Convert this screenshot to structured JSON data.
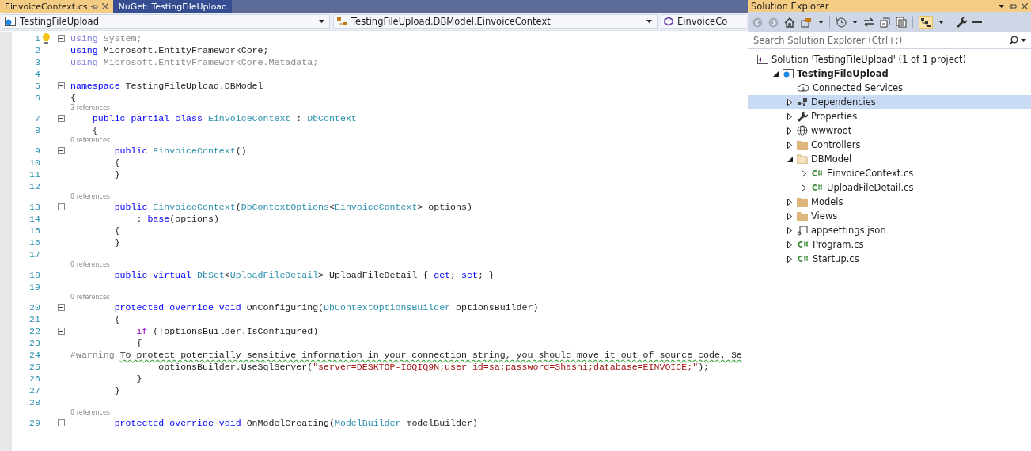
{
  "tabs": [
    {
      "label": "EinvoiceContext.cs",
      "selected": true,
      "pinned": true
    },
    {
      "label": "NuGet: TestingFileUpload",
      "selected": false,
      "pinned": false
    }
  ],
  "nav_bar": [
    {
      "label": "TestingFileUpload",
      "kind": "project"
    },
    {
      "label": "TestingFileUpload.DBModel.EinvoiceContext",
      "kind": "class"
    },
    {
      "label": "EinvoiceCo",
      "kind": "member"
    }
  ],
  "editor": {
    "lines": [
      {
        "number": "1",
        "fold": true,
        "lightbulb": true,
        "tokens": [
          {
            "kind": "unused_kw",
            "text": "using"
          },
          {
            "kind": "unused",
            "text": " System;"
          }
        ]
      },
      {
        "number": "2",
        "fold": false,
        "lightbulb": false,
        "tokens": [
          {
            "kind": "kw",
            "text": "using"
          },
          {
            "kind": "plain",
            "text": " Microsoft.EntityFrameworkCore;"
          }
        ]
      },
      {
        "number": "3",
        "fold": false,
        "lightbulb": false,
        "tokens": [
          {
            "kind": "unused_kw",
            "text": "using"
          },
          {
            "kind": "unused",
            "text": " Microsoft.EntityFrameworkCore.Metadata;"
          }
        ]
      },
      {
        "number": "4",
        "fold": false,
        "lightbulb": false
      },
      {
        "number": "5",
        "fold": true,
        "lightbulb": false,
        "tokens": [
          {
            "kind": "kw",
            "text": "namespace"
          },
          {
            "kind": "plain",
            "text": " TestingFileUpload.DBModel"
          }
        ]
      },
      {
        "number": "6",
        "fold": false,
        "lightbulb": false,
        "tokens": [
          {
            "kind": "plain",
            "text": "{"
          }
        ]
      },
      {
        "number": "7",
        "fold": true,
        "lightbulb": false,
        "codelens": "3 references",
        "tokens": [
          {
            "kind": "kw",
            "text": "    public partial class"
          },
          {
            "kind": "type",
            "text": " EinvoiceContext"
          },
          {
            "kind": "plain",
            "text": " : "
          },
          {
            "kind": "type",
            "text": "DbContext"
          }
        ]
      },
      {
        "number": "8",
        "fold": false,
        "lightbulb": false,
        "tokens": [
          {
            "kind": "plain",
            "text": "    {"
          }
        ]
      },
      {
        "number": "9",
        "fold": true,
        "lightbulb": false,
        "codelens": "0 references",
        "tokens": [
          {
            "kind": "kw",
            "text": "        public"
          },
          {
            "kind": "type",
            "text": " EinvoiceContext"
          },
          {
            "kind": "plain",
            "text": "()"
          }
        ]
      },
      {
        "number": "10",
        "fold": false,
        "lightbulb": false,
        "tokens": [
          {
            "kind": "plain",
            "text": "        {"
          }
        ]
      },
      {
        "number": "11",
        "fold": false,
        "lightbulb": false,
        "tokens": [
          {
            "kind": "plain",
            "text": "        }"
          }
        ]
      },
      {
        "number": "12",
        "fold": false,
        "lightbulb": false
      },
      {
        "number": "13",
        "fold": true,
        "lightbulb": false,
        "codelens": "0 references",
        "tokens": [
          {
            "kind": "kw",
            "text": "        public"
          },
          {
            "kind": "type",
            "text": " EinvoiceContext"
          },
          {
            "kind": "plain",
            "text": "("
          },
          {
            "kind": "type",
            "text": "DbContextOptions"
          },
          {
            "kind": "plain",
            "text": "<"
          },
          {
            "kind": "type",
            "text": "EinvoiceContext"
          },
          {
            "kind": "plain",
            "text": "> options)"
          }
        ]
      },
      {
        "number": "14",
        "fold": false,
        "lightbulb": false,
        "tokens": [
          {
            "kind": "plain",
            "text": "            : "
          },
          {
            "kind": "kw",
            "text": "base"
          },
          {
            "kind": "plain",
            "text": "(options)"
          }
        ]
      },
      {
        "number": "15",
        "fold": false,
        "lightbulb": false,
        "tokens": [
          {
            "kind": "plain",
            "text": "        {"
          }
        ]
      },
      {
        "number": "16",
        "fold": false,
        "lightbulb": false,
        "tokens": [
          {
            "kind": "plain",
            "text": "        }"
          }
        ]
      },
      {
        "number": "17",
        "fold": false,
        "lightbulb": false
      },
      {
        "number": "18",
        "fold": false,
        "lightbulb": false,
        "codelens": "0 references",
        "tokens": [
          {
            "kind": "kw",
            "text": "        public virtual"
          },
          {
            "kind": "type",
            "text": " DbSet"
          },
          {
            "kind": "plain",
            "text": "<"
          },
          {
            "kind": "type",
            "text": "UploadFileDetail"
          },
          {
            "kind": "plain",
            "text": "> UploadFileDetail { "
          },
          {
            "kind": "kw",
            "text": "get"
          },
          {
            "kind": "plain",
            "text": "; "
          },
          {
            "kind": "kw",
            "text": "set"
          },
          {
            "kind": "plain",
            "text": "; }"
          }
        ]
      },
      {
        "number": "19",
        "fold": false,
        "lightbulb": false
      },
      {
        "number": "20",
        "fold": true,
        "lightbulb": false,
        "codelens": "0 references",
        "tokens": [
          {
            "kind": "kw",
            "text": "        protected override void"
          },
          {
            "kind": "plain",
            "text": " OnConfiguring("
          },
          {
            "kind": "type",
            "text": "DbContextOptionsBuilder"
          },
          {
            "kind": "plain",
            "text": " optionsBuilder)"
          }
        ]
      },
      {
        "number": "21",
        "fold": false,
        "lightbulb": false,
        "tokens": [
          {
            "kind": "plain",
            "text": "        {"
          }
        ]
      },
      {
        "number": "22",
        "fold": true,
        "lightbulb": false,
        "tokens": [
          {
            "kind": "ctrl",
            "text": "            if"
          },
          {
            "kind": "plain",
            "text": " (!optionsBuilder.IsConfigured)"
          }
        ]
      },
      {
        "number": "23",
        "fold": false,
        "lightbulb": false,
        "tokens": [
          {
            "kind": "plain",
            "text": "            {"
          }
        ]
      },
      {
        "number": "24",
        "fold": false,
        "lightbulb": false,
        "tokens": [
          {
            "kind": "directive",
            "text": "#warning "
          },
          {
            "kind": "warning",
            "text": "To protect potentially sensitive information in your connection string, you should move it out of source code. Se"
          }
        ]
      },
      {
        "number": "25",
        "fold": false,
        "lightbulb": false,
        "tokens": [
          {
            "kind": "plain",
            "text": "                optionsBuilder.UseSqlServer("
          },
          {
            "kind": "string",
            "text": "\"server=DESKTOP-I6QIQ9N;user id=sa;password=Shashi;database=EINVOICE;\""
          },
          {
            "kind": "plain",
            "text": ");"
          }
        ]
      },
      {
        "number": "26",
        "fold": false,
        "lightbulb": false,
        "tokens": [
          {
            "kind": "plain",
            "text": "            }"
          }
        ]
      },
      {
        "number": "27",
        "fold": false,
        "lightbulb": false,
        "tokens": [
          {
            "kind": "plain",
            "text": "        }"
          }
        ]
      },
      {
        "number": "28",
        "fold": false,
        "lightbulb": false
      },
      {
        "number": "29",
        "fold": true,
        "lightbulb": false,
        "codelens": "0 references",
        "tokens": [
          {
            "kind": "kw",
            "text": "        protected override void"
          },
          {
            "kind": "plain",
            "text": " OnModelCreating("
          },
          {
            "kind": "type",
            "text": "ModelBuilder"
          },
          {
            "kind": "plain",
            "text": " modelBuilder)"
          }
        ]
      }
    ]
  },
  "solution_explorer": {
    "title": "Solution Explorer",
    "search": {
      "placeholder": "Search Solution Explorer (Ctrl+;)"
    },
    "tree": [
      {
        "label": "Solution 'TestingFileUpload' (1 of 1 project)",
        "kind": "solution",
        "selected": false,
        "children": [
          {
            "label": "TestingFileUpload",
            "kind": "project",
            "expanded": true,
            "selected": false,
            "children": [
              {
                "label": "Connected Services",
                "kind": "cloud",
                "selected": false
              },
              {
                "label": "Dependencies",
                "kind": "dependencies",
                "expanded": false,
                "selected": true
              },
              {
                "label": "Properties",
                "kind": "wrench",
                "expanded": false,
                "selected": false
              },
              {
                "label": "wwwroot",
                "kind": "globe",
                "expanded": false,
                "selected": false
              },
              {
                "label": "Controllers",
                "kind": "folder",
                "expanded": false,
                "selected": false
              },
              {
                "label": "DBModel",
                "kind": "folder_open",
                "expanded": true,
                "selected": false,
                "children": [
                  {
                    "label": "EinvoiceContext.cs",
                    "kind": "csharp",
                    "expanded": false,
                    "selected": false
                  },
                  {
                    "label": "UploadFileDetail.cs",
                    "kind": "csharp",
                    "expanded": false,
                    "selected": false
                  }
                ]
              },
              {
                "label": "Models",
                "kind": "folder",
                "expanded": false,
                "selected": false
              },
              {
                "label": "Views",
                "kind": "folder",
                "expanded": false,
                "selected": false
              },
              {
                "label": "appsettings.json",
                "kind": "json",
                "expanded": false,
                "selected": false
              },
              {
                "label": "Program.cs",
                "kind": "csharp",
                "expanded": false,
                "selected": false
              },
              {
                "label": "Startup.cs",
                "kind": "csharp",
                "expanded": false,
                "selected": false
              }
            ]
          }
        ]
      }
    ]
  }
}
